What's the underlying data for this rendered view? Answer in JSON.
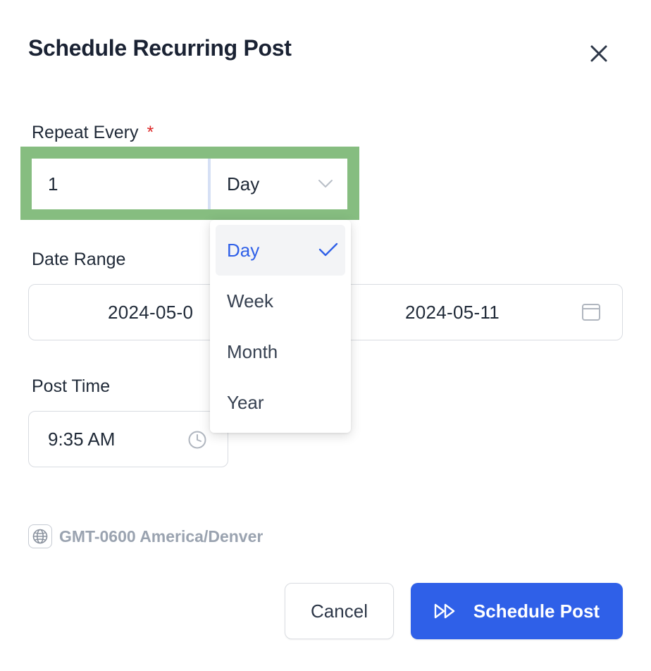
{
  "dialog": {
    "title": "Schedule Recurring Post"
  },
  "repeat": {
    "label": "Repeat Every",
    "required_mark": "*",
    "interval_value": "1",
    "unit_selected": "Day",
    "unit_options": [
      "Day",
      "Week",
      "Month",
      "Year"
    ]
  },
  "date_range": {
    "label": "Date Range",
    "start": "2024-05-0",
    "end": "2024-05-11"
  },
  "post_time": {
    "label": "Post Time",
    "value": "9:35 AM"
  },
  "timezone": {
    "text": "GMT-0600 America/Denver"
  },
  "actions": {
    "cancel_label": "Cancel",
    "schedule_label": "Schedule Post"
  },
  "icons": {
    "close": "close-icon",
    "dropdown": "chevron-down-icon",
    "calendar": "calendar-icon",
    "clock": "clock-icon",
    "globe": "globe-icon",
    "check": "check-icon",
    "schedule": "fast-forward-icon"
  },
  "colors": {
    "primary": "#2f60e8",
    "required": "#dc2626",
    "highlight": "#86bd80",
    "muted": "#9aa3b0"
  }
}
